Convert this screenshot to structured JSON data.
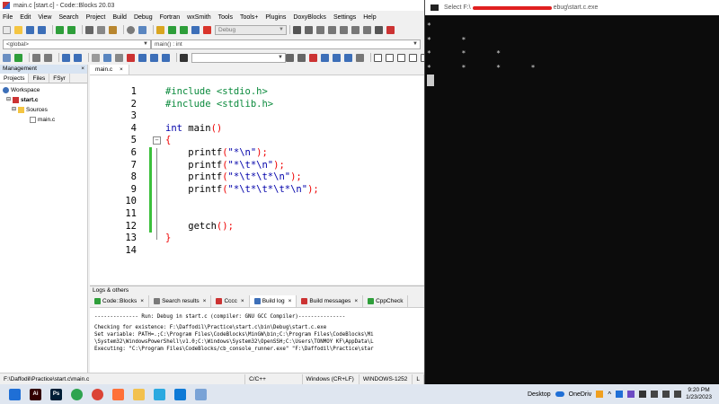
{
  "codeblocks": {
    "title": "main.c [start.c] - Code::Blocks 20.03",
    "menu": [
      "File",
      "Edit",
      "View",
      "Search",
      "Project",
      "Build",
      "Debug",
      "Fortran",
      "wxSmith",
      "Tools",
      "Tools+",
      "Plugins",
      "DoxyBlocks",
      "Settings",
      "Help"
    ],
    "toolbar": {
      "build_target": "Debug",
      "scope": "<global>",
      "function": "main() : int"
    },
    "management": {
      "title": "Management",
      "close": "×",
      "tabs": [
        "Projects",
        "Files",
        "FSyr"
      ],
      "tree": {
        "workspace": "Workspace",
        "project": "start.c",
        "folder": "Sources",
        "file": "main.c"
      }
    },
    "editor": {
      "tab": "main.c",
      "tab_close": "×",
      "lines": [
        {
          "n": "1",
          "code": "#include <stdio.h>"
        },
        {
          "n": "2",
          "code": "#include <stdlib.h>"
        },
        {
          "n": "3",
          "code": ""
        },
        {
          "n": "4",
          "code": "int main()"
        },
        {
          "n": "5",
          "code": "{"
        },
        {
          "n": "6",
          "code": "    printf(\"*\\n\");"
        },
        {
          "n": "7",
          "code": "    printf(\"*\\t*\\n\");"
        },
        {
          "n": "8",
          "code": "    printf(\"*\\t*\\t*\\n\");"
        },
        {
          "n": "9",
          "code": "    printf(\"*\\t*\\t*\\t*\\n\");"
        },
        {
          "n": "10",
          "code": ""
        },
        {
          "n": "11",
          "code": ""
        },
        {
          "n": "12",
          "code": "    getch();"
        },
        {
          "n": "13",
          "code": "}"
        },
        {
          "n": "14",
          "code": ""
        }
      ]
    },
    "logs": {
      "title": "Logs & others",
      "tabs": [
        "Code::Blocks",
        "Search results",
        "Cccc",
        "Build log",
        "Build messages",
        "CppCheck"
      ],
      "active_tab": "Build log",
      "lines": [
        "-------------- Run: Debug in start.c (compiler: GNU GCC Compiler)---------------",
        "Checking for existence: F:\\Daffodil\\Practice\\start.c\\bin\\Debug\\start.c.exe",
        "Set variable: PATH=.;C:\\Program Files\\CodeBlocks\\MinGW\\bin;C:\\Program Files\\CodeBlocks\\Mi",
        "\\System32\\WindowsPowerShell\\v1.0;C:\\Windows\\System32\\OpenSSH;C:\\Users\\TONMOY KF\\AppData\\L",
        "Executing: \"C:\\Program Files\\CodeBlocks/cb_console_runner.exe\" \"F:\\Daffodil\\Practice\\star"
      ]
    },
    "status": {
      "path": "F:\\Daffodil\\Practice\\start.c\\main.c",
      "language": "C/C++",
      "eol": "Windows (CR+LF)",
      "encoding": "WINDOWS-1252",
      "tail": "L"
    }
  },
  "console": {
    "title_prefix": "Select F:\\",
    "title_suffix": "ebug\\start.c.exe",
    "output": [
      "*",
      "*       *",
      "*       *       *",
      "*       *       *       *",
      ""
    ]
  },
  "taskbar": {
    "apps": [
      {
        "name": "windows-start",
        "label": "",
        "color": "#1f6fd6"
      },
      {
        "name": "illustrator",
        "label": "Ai",
        "color": "#330000"
      },
      {
        "name": "photoshop",
        "label": "Ps",
        "color": "#001e36"
      },
      {
        "name": "chrome",
        "label": "",
        "color": "#2ea44f"
      },
      {
        "name": "chrome-profile",
        "label": "",
        "color": "#db4437"
      },
      {
        "name": "firefox",
        "label": "",
        "color": "#ff7139"
      },
      {
        "name": "file-explorer",
        "label": "",
        "color": "#f2c14e"
      },
      {
        "name": "remote-app",
        "label": "",
        "color": "#2aa9e0"
      },
      {
        "name": "edge",
        "label": "",
        "color": "#0e7ad6"
      },
      {
        "name": "codeblocks-taskbar",
        "label": "",
        "color": "#7aa3d6"
      }
    ],
    "desktop": "Desktop",
    "onedrive": "OneDriv",
    "time": "9:20 PM",
    "date": "1/23/2023"
  }
}
